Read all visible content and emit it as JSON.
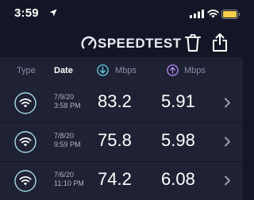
{
  "status_bar": {
    "time": "3:59"
  },
  "header": {
    "brand": "SPEEDTEST"
  },
  "columns": {
    "type": "Type",
    "date": "Date",
    "download": "Mbps",
    "upload": "Mbps"
  },
  "colors": {
    "background": "#141526",
    "row": "#1f2134",
    "download_accent": "#5fd2e6",
    "upload_accent": "#b18cf2",
    "battery": "#f7d04a"
  },
  "icons": [
    "location-arrow-icon",
    "signal-icon",
    "wifi-icon",
    "battery-icon",
    "speedtest-logo-icon",
    "trash-icon",
    "share-icon",
    "download-arrow-icon",
    "upload-arrow-icon",
    "wifi-type-icon",
    "chevron-right-icon"
  ],
  "results": [
    {
      "date": "7/9/20",
      "time": "3:58 PM",
      "download": "83.2",
      "upload": "5.91"
    },
    {
      "date": "7/8/20",
      "time": "9:59 PM",
      "download": "75.8",
      "upload": "5.98"
    },
    {
      "date": "7/6/20",
      "time": "11:10 PM",
      "download": "74.2",
      "upload": "6.08"
    }
  ]
}
